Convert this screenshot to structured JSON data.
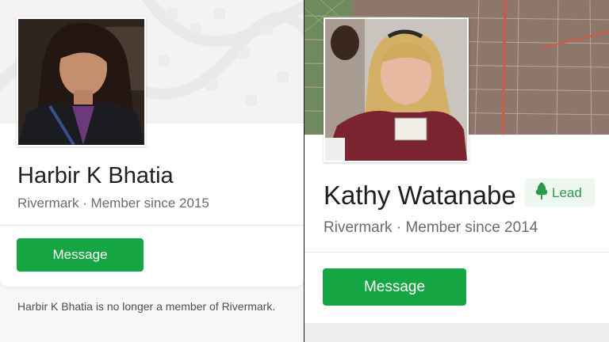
{
  "left_profile": {
    "name": "Harbir K Bhatia",
    "subtitle": "Rivermark · Member since 2015",
    "message_button": "Message",
    "notice": "Harbir K Bhatia is no longer a member of Rivermark."
  },
  "right_profile": {
    "name": "Kathy Watanabe",
    "subtitle": "Rivermark · Member since 2014",
    "message_button": "Message",
    "badge": {
      "label": "Lead",
      "icon": "tree-icon"
    }
  },
  "colors": {
    "accent_green": "#16a543",
    "badge_bg": "#eef7f0",
    "badge_text": "#2a9a4a",
    "text_primary": "#1f1f1f",
    "text_secondary": "#6b6b6b"
  }
}
